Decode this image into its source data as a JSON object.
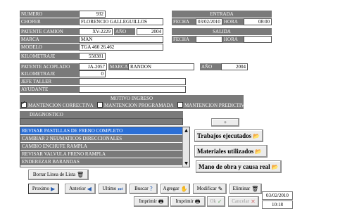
{
  "vehicle": {
    "numero_label": "NUMERO",
    "numero_value": "932",
    "chofer_label": "CHOFER",
    "chofer_value": "FLORENCIO GALLEGUILLOS",
    "patente_camion_label": "PATENTE CAMION",
    "patente_camion_value": "XV-2229",
    "ano_label": "AÑO",
    "ano_value": "2004",
    "marca_label": "MARCA",
    "marca_value": "MAN",
    "modelo_label": "MODELO",
    "modelo_value": "TGA 460 26.462",
    "kilometraje_label": "KILOMETRAJE",
    "kilometraje_value": "558381",
    "patente_acoplado_label": "PATENTE ACOPLADO",
    "patente_acoplado_value": "JA-2057",
    "marca2_label": "MARCA",
    "marca2_value": "RANDON",
    "ano2_label": "AÑO",
    "ano2_value": "2004",
    "kilometraje2_label": "KILOMETRAJE",
    "kilometraje2_value": "0",
    "jefe_taller_label": "JEFE TALLER",
    "jefe_taller_value": "",
    "ayudante_label": "AYUDANTE",
    "ayudante_value": ""
  },
  "entrada": {
    "title": "ENTRADA",
    "fecha_label": "FECHA",
    "fecha_value": "03/02/2010",
    "hora_label": "HORA",
    "hora_value": "08:00"
  },
  "salida": {
    "title": "SALIDA",
    "fecha_label": "FECHA",
    "fecha_value": "",
    "hora_label": "HORA",
    "hora_value": ""
  },
  "motivo": {
    "title": "MOTIVO INGRESO",
    "options": [
      {
        "label": "MANTENCION CORRECTIVA",
        "checked": true
      },
      {
        "label": "MANTENCION PROGRAMADA",
        "checked": false
      },
      {
        "label": "MANTENCION PREDICTIVA",
        "checked": false
      }
    ]
  },
  "diagnostico": {
    "title": "DIAGNOSTICO",
    "input_value": "",
    "items": [
      "REVISAR PASTILLAS DE FRENO COMPLETO",
      "CAMBIAR 2 NEUMATICOS DIRECCIONALES",
      "CAMBIO ENCHUFE RAMPLA",
      "REVISAR VALVULA FRENO RAMPLA",
      "ENDEREZAR BARANDAS"
    ],
    "selected_index": 0,
    "add_label": "+",
    "borrar_label": "Borrar Linea de Lista"
  },
  "side_buttons": {
    "trabajos": "Trabajos ejecutados",
    "materiales": "Materiales utilizados",
    "mano_obra": "Mano de obra y causa real"
  },
  "nav": {
    "proximo": "Proximo",
    "anterior": "Anterior",
    "ultimo": "Ultimo",
    "buscar": "Buscar",
    "agregar": "Agregar",
    "modificar": "Modificar",
    "eliminar": "Eliminar",
    "imprimir1": "Imprimir",
    "imprimir2": "Imprimir",
    "ok": "Ok",
    "cancelar": "Cancelar"
  },
  "status": {
    "date": "03/02/2010",
    "time": "10:18"
  }
}
